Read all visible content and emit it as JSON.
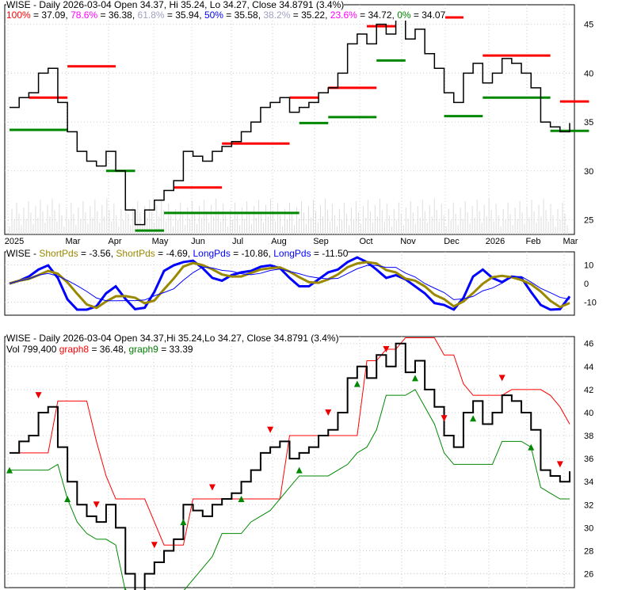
{
  "chart_data": [
    {
      "type": "line",
      "title": "WISE - Daily 2026-03-04 Open 34.37, Hi 35.24, Lo 34.27, Close 34.8791 (3.4%)",
      "fib": [
        {
          "label": "100%",
          "value": "37.09",
          "color": "#ff0000"
        },
        {
          "label": "78.6%",
          "value": "36.38",
          "color": "#ff00ff"
        },
        {
          "label": "61.8%",
          "value": "35.94",
          "color": "#a0a0c0"
        },
        {
          "label": "50%",
          "value": "35.58",
          "color": "#0000ff"
        },
        {
          "label": "38.2%",
          "value": "35.22",
          "color": "#a0a0c0"
        },
        {
          "label": "23.6%",
          "value": "34.72",
          "color": "#ff00ff"
        },
        {
          "label": "0%",
          "value": "34.07",
          "color": "#008000"
        }
      ],
      "ylim": [
        23.5,
        47
      ],
      "yticks": [
        25,
        30,
        35,
        40,
        45
      ],
      "xticks": [
        "2025",
        "Mar",
        "Apr",
        "May",
        "Jun",
        "Jul",
        "Aug",
        "Sep",
        "Oct",
        "Nov",
        "Dec",
        "2026",
        "Feb",
        "Mar"
      ],
      "weekly_close": [
        36.5,
        37.5,
        38,
        40,
        40.5,
        37,
        34,
        32,
        31,
        30.5,
        32,
        30,
        26,
        24.5,
        26,
        27,
        28,
        29,
        32,
        31.5,
        31,
        32,
        32.5,
        33,
        34,
        35,
        36.5,
        37,
        37.5,
        36,
        36.5,
        37,
        38,
        38.5,
        40,
        43,
        44,
        43,
        45,
        44,
        46,
        43.5,
        44.5,
        42,
        40.5,
        38,
        37,
        40,
        41,
        39,
        40,
        41.5,
        41,
        40,
        38.5,
        35,
        34.5,
        34,
        34.9
      ],
      "resistance": [
        [
          2,
          6,
          37.5
        ],
        [
          6,
          11,
          40.7
        ],
        [
          17,
          22,
          28.3
        ],
        [
          22,
          29,
          32.8
        ],
        [
          29,
          32,
          37.5
        ],
        [
          33,
          38,
          38.5
        ],
        [
          37,
          40,
          44.8
        ],
        [
          41,
          47,
          45.7
        ],
        [
          49,
          56,
          41.8
        ],
        [
          57,
          60,
          37.1
        ]
      ],
      "support": [
        [
          0,
          6,
          34.2
        ],
        [
          10,
          13,
          30
        ],
        [
          13,
          16,
          23.9
        ],
        [
          16,
          30,
          25.7
        ],
        [
          30,
          33,
          34.9
        ],
        [
          33,
          38,
          35.5
        ],
        [
          38,
          41,
          41.3
        ],
        [
          45,
          49,
          35.6
        ],
        [
          49,
          56,
          37.5
        ],
        [
          56,
          60,
          34.1
        ]
      ]
    },
    {
      "type": "line",
      "title_parts": [
        {
          "t": "WISE - ",
          "c": "#000"
        },
        {
          "t": "ShortPds",
          "c": "#998800"
        },
        {
          "t": " = -3.56, ",
          "c": "#000"
        },
        {
          "t": "ShortPds",
          "c": "#998800"
        },
        {
          "t": " = -4.69, ",
          "c": "#000"
        },
        {
          "t": "LongPds",
          "c": "#0000ff"
        },
        {
          "t": " = -10.86, ",
          "c": "#000"
        },
        {
          "t": "LongPds",
          "c": "#0000ff"
        },
        {
          "t": " = -11.50",
          "c": "#000"
        }
      ],
      "ylim": [
        -17,
        17
      ],
      "yticks": [
        10,
        0,
        -10
      ]
    },
    {
      "type": "line",
      "title": "WISE - Daily 2026-03-04 Open 34.37,Hi 35.24,Lo 34.27, Close 34.8791 (3.4%)",
      "sub_parts": [
        {
          "t": "Vol 799,400 ",
          "c": "#000"
        },
        {
          "t": "graph8",
          "c": "#ff0000"
        },
        {
          "t": " = 36.48, ",
          "c": "#000"
        },
        {
          "t": "graph9",
          "c": "#008000"
        },
        {
          "t": " = 33.39",
          "c": "#000"
        }
      ],
      "ylim": [
        24.8,
        46.6
      ],
      "yticks": [
        26,
        28,
        30,
        32,
        34,
        36,
        38,
        40,
        42,
        44,
        46
      ]
    }
  ]
}
